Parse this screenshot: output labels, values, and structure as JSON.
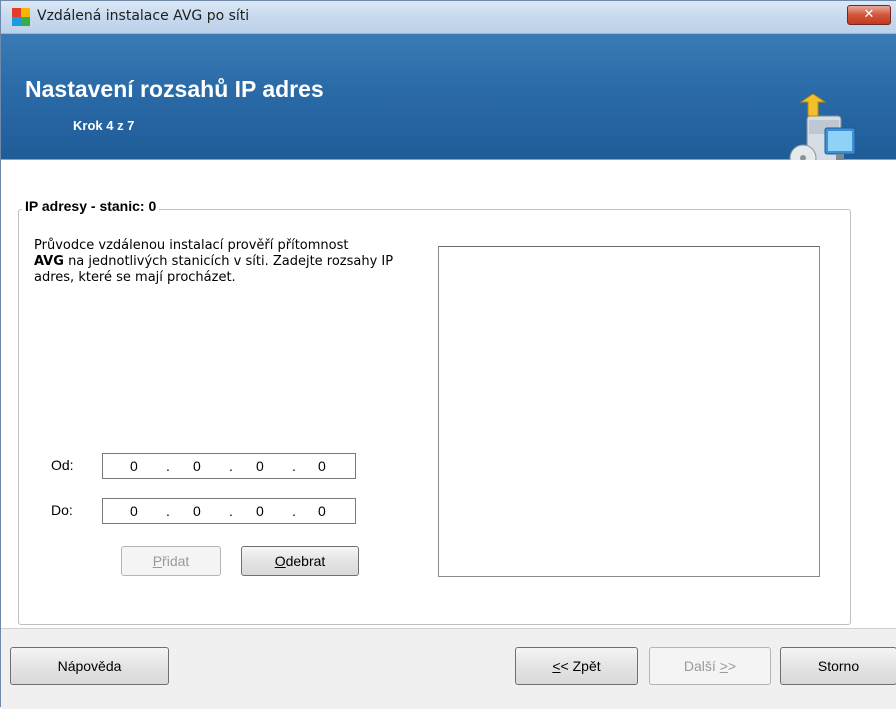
{
  "window": {
    "title": "Vzdálená instalace AVG po síti",
    "close_label": "✕"
  },
  "banner": {
    "title": "Nastavení rozsahů IP adres",
    "step": "Krok 4 z 7"
  },
  "group": {
    "title": "IP adresy - stanic: 0",
    "desc_before": "Průvodce vzdálenou instalací prověří přítomnost",
    "desc_bold": "AVG",
    "desc_after": "na jednotlivých stanicích v síti. Zadejte rozsahy IP adres, které se mají procházet."
  },
  "ip_from": {
    "label": "Od:",
    "octets": [
      "0",
      "0",
      "0",
      "0"
    ]
  },
  "ip_to": {
    "label": "Do:",
    "octets": [
      "0",
      "0",
      "0",
      "0"
    ]
  },
  "buttons": {
    "add": {
      "accel": "P",
      "rest": "řidat",
      "enabled": false
    },
    "remove": {
      "accel": "O",
      "rest": "debrat",
      "enabled": true
    }
  },
  "footer": {
    "help": "Nápověda",
    "back_accel": "<",
    "back_rest": "< Zpět",
    "next_before": "Další ",
    "next_accel": ">",
    "next_after": ">",
    "cancel": "Storno"
  },
  "colors": {
    "banner": "#2a6aa6",
    "close": "#c33b20"
  },
  "icons": {
    "app": "avg-logo-icon",
    "banner": "computer-install-icon"
  }
}
